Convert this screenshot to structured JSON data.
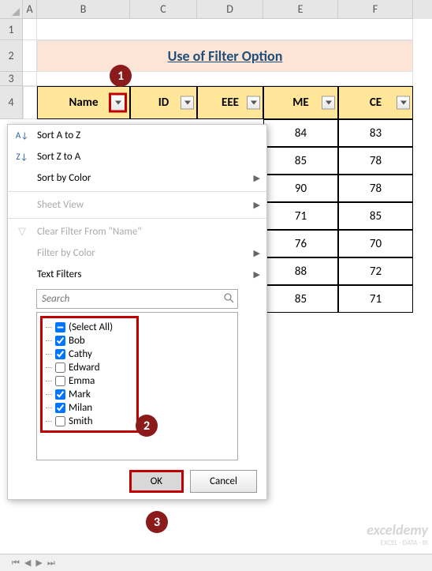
{
  "columns": [
    "A",
    "B",
    "C",
    "D",
    "E",
    "F"
  ],
  "rows": [
    "1",
    "2",
    "3",
    "4"
  ],
  "title": "Use of Filter Option",
  "headers": [
    "Name",
    "ID",
    "EEE",
    "ME",
    "CE"
  ],
  "visible_data": {
    "ME": [
      84,
      85,
      90,
      71,
      76,
      88,
      85
    ],
    "CE": [
      83,
      78,
      78,
      85,
      70,
      72,
      71
    ]
  },
  "filter_menu": {
    "sort_az": "Sort A to Z",
    "sort_za": "Sort Z to A",
    "sort_color": "Sort by Color",
    "sheet_view": "Sheet View",
    "clear_filter": "Clear Filter From \"Name\"",
    "filter_color": "Filter by Color",
    "text_filters": "Text Filters",
    "search_placeholder": "Search",
    "items": [
      {
        "label": "(Select All)",
        "state": "tristate"
      },
      {
        "label": "Bob",
        "state": "checked"
      },
      {
        "label": "Cathy",
        "state": "checked"
      },
      {
        "label": "Edward",
        "state": "unchecked"
      },
      {
        "label": "Emma",
        "state": "unchecked"
      },
      {
        "label": "Mark",
        "state": "checked"
      },
      {
        "label": "Milan",
        "state": "checked"
      },
      {
        "label": "Smith",
        "state": "unchecked"
      }
    ],
    "ok": "OK",
    "cancel": "Cancel"
  },
  "callouts": {
    "c1": "1",
    "c2": "2",
    "c3": "3"
  },
  "watermark": {
    "brand": "exceldemy",
    "tag": "EXCEL · DATA · BI"
  }
}
